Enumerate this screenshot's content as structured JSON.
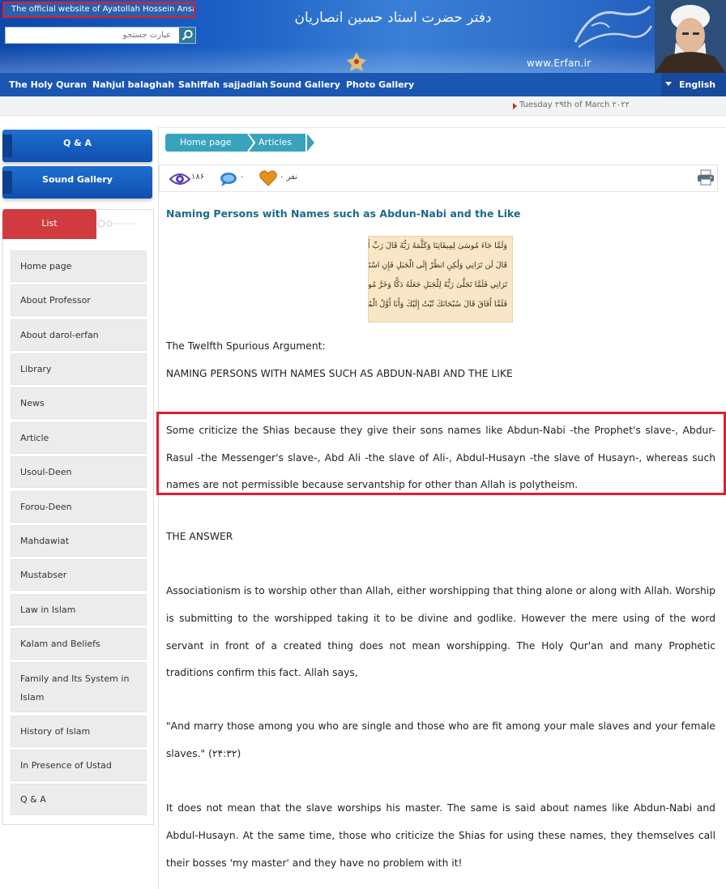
{
  "header": {
    "official_text": "The official website of Ayatollah Hossein Ansarian",
    "search_placeholder": "عبارت جستجو",
    "calligraphy_text": "دفتر حضرت استاد حسین انصاریان",
    "site_url": "www.Erfan.ir"
  },
  "nav": {
    "items": [
      "The Holy Quran",
      "Nahjul balaghah",
      "Sahiffah sajjadiah",
      "Sound Gallery",
      "Photo Gallery"
    ],
    "language": "English"
  },
  "date": "Tuesday ۲۹th of March ۲۰۲۲",
  "sidebar": {
    "buttons": [
      "Q & A",
      "Sound Gallery"
    ],
    "list_tab": "List",
    "menu": [
      "Home page",
      "About Professor",
      "About darol-erfan",
      "Library",
      "News",
      "Article",
      "Usoul-Deen",
      "Forou-Deen",
      "Mahdawiat",
      "Mustabser",
      "Law in Islam",
      "Kalam and Beliefs",
      "Family and Its System in Islam",
      "History of Islam",
      "In Presence of Ustad",
      "Q & A"
    ]
  },
  "breadcrumb": [
    "Home page",
    "Articles"
  ],
  "stats": {
    "views": "۱۸۶",
    "comments": "۰",
    "likes": "نفر ۰"
  },
  "article": {
    "title": "Naming Persons with Names such as Abdun-Nabi and the Like",
    "verse_lines": [
      "وَلَمَّا جَاءَ مُوسَىٰ لِمِيقَاتِنَا وَكَلَّمَهُ رَبُّهُ قَالَ رَبِّ أَرِنِي أَنظُرْ إِلَيْكَ",
      "قَالَ لَن تَرَانِي وَلَٰكِنِ انظُرْ إِلَى الْجَبَلِ فَإِنِ اسْتَقَرَّ مَكَانَهُ فَسَوْفَ",
      "تَرَانِي فَلَمَّا تَجَلَّىٰ رَبُّهُ لِلْجَبَلِ جَعَلَهُ دَكًّا وَخَرَّ مُوسَىٰ صَعِقًا",
      "فَلَمَّا أَفَاقَ قَالَ سُبْحَانَكَ تُبْتُ إِلَيْكَ وَأَنَا أَوَّلُ الْمُؤْمِنِينَ"
    ],
    "intro": "The Twelfth Spurious Argument:",
    "subtitle": "NAMING PERSONS WITH NAMES SUCH AS ABDUN-NABI AND THE LIKE",
    "para1": "Some criticize the Shias because they give their sons names like Abdun-Nabi -the Prophet's slave-, Abdur-Rasul -the Messenger's slave-, Abd Ali -the slave of Ali-, Abdul-Husayn -the slave of Husayn-, whereas such names are not permissible because servantship for other than Allah is polytheism.",
    "answer_heading": "THE ANSWER",
    "para2": "Associationism is to worship other than Allah, either worshipping that thing alone or along with Allah. Worship is submitting to the worshipped taking it to be divine and godlike. However the mere using of the word servant in front of a created thing does not mean worshipping. The Holy Qur'an and many Prophetic traditions confirm this fact. Allah says,",
    "quote": "\"And marry those among you who are single and those who are fit among your male slaves and your female slaves.\" (۲۴:۳۲)",
    "para3": "It does not mean that the slave worships his master. The same is said about names like Abdun-Nabi and Abdul-Husayn. At the same time, those who criticize the Shias for using these names, they themselves call their bosses 'my master' and they have no problem with it!"
  },
  "colors": {
    "nav_bg": "#1b56b2",
    "accent_teal": "#39a3bd",
    "title_color": "#1c6a8a",
    "list_tab": "#cf3b3e",
    "highlight": "#e21d2c"
  }
}
